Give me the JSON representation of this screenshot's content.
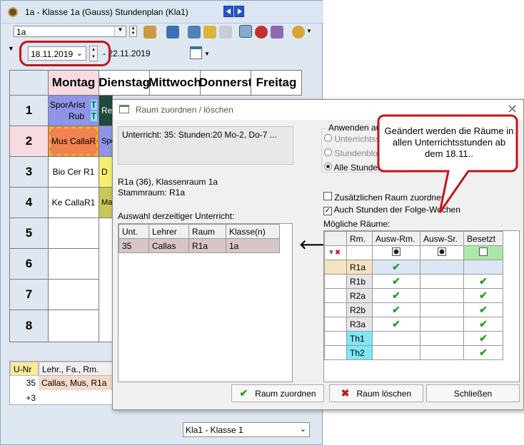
{
  "window": {
    "title": "1a - Klasse 1a (Gauss)  Stundenplan  (Kla1)",
    "class_combo": "1a",
    "date_from": "18.11.2019",
    "date_to": "- 22.11.2019",
    "footer_combo": "Kla1 - Klasse 1"
  },
  "timetable": {
    "days": [
      "Montag",
      "Dienstag",
      "Mittwoch",
      "Donnerst",
      "Freitag"
    ],
    "periods": [
      "1",
      "2",
      "3",
      "4",
      "5",
      "6",
      "7",
      "8"
    ],
    "monday": [
      {
        "l1": "SporArist",
        "l2": "Rub",
        "t1": "T",
        "t2": "T"
      },
      {
        "text": "Mus CallaR"
      },
      {
        "text": "Bio Cer  R1"
      },
      {
        "text": "Ke CallaR1"
      }
    ],
    "tuesday_fragments": [
      "Re",
      "Spo",
      "D",
      "Ma"
    ]
  },
  "lower_panel": {
    "headers": [
      "U-Nr",
      "Lehr., Fa., Rm."
    ],
    "row": {
      "nr": "35",
      "info": "Callas, Mus, R1a"
    },
    "more": "+3"
  },
  "dialog": {
    "title": "Raum zuordnen / löschen",
    "info": "Unterricht: 35: Stunden:20 Mo-2, Do-7 ...",
    "room_line1": "R1a (36), Klassenraum 1a",
    "room_line2": "Stammraum: R1a",
    "apply_group": "Anwenden auf",
    "radio1": "Unterrichtsst",
    "radio2": "Stundenbloc",
    "radio3": "Alle Stunden d",
    "check1": "Zusätzlichen Raum zuordnen",
    "check2": "Auch Stunden der Folge-Wochen",
    "current_label": "Auswahl derzeitiger Unterricht:",
    "current_headers": [
      "Unt.",
      "Lehrer",
      "Raum",
      "Klasse(n)"
    ],
    "current_row": [
      "35",
      "Callas",
      "R1a",
      "1a"
    ],
    "possible_label": "Mögliche Räume:",
    "rooms_headers": [
      "Rm.",
      "Ausw-Rm.",
      "Ausw-Sr.",
      "Besetzt"
    ],
    "rooms": [
      {
        "name": "R1a",
        "ausw_rm": true,
        "ausw_sr": false,
        "besetzt": false
      },
      {
        "name": "R1b",
        "ausw_rm": true,
        "ausw_sr": false,
        "besetzt": true
      },
      {
        "name": "R2a",
        "ausw_rm": true,
        "ausw_sr": false,
        "besetzt": true
      },
      {
        "name": "R2b",
        "ausw_rm": true,
        "ausw_sr": false,
        "besetzt": true
      },
      {
        "name": "R3a",
        "ausw_rm": true,
        "ausw_sr": false,
        "besetzt": true
      },
      {
        "name": "Th1",
        "ausw_rm": false,
        "ausw_sr": false,
        "besetzt": true
      },
      {
        "name": "Th2",
        "ausw_rm": false,
        "ausw_sr": false,
        "besetzt": true
      }
    ],
    "btn_assign": "Raum zuordnen",
    "btn_delete": "Raum löschen",
    "btn_close": "Schließen"
  },
  "callout": {
    "text": "Geändert werden die Räume in allen Unterrichtsstunden ab dem 18.11.."
  },
  "colors": {
    "accent_red": "#c0161c",
    "check_green": "#2a9a2a",
    "room_cyan": "#7fe7f5",
    "selected_row": "#d8c6c6"
  }
}
